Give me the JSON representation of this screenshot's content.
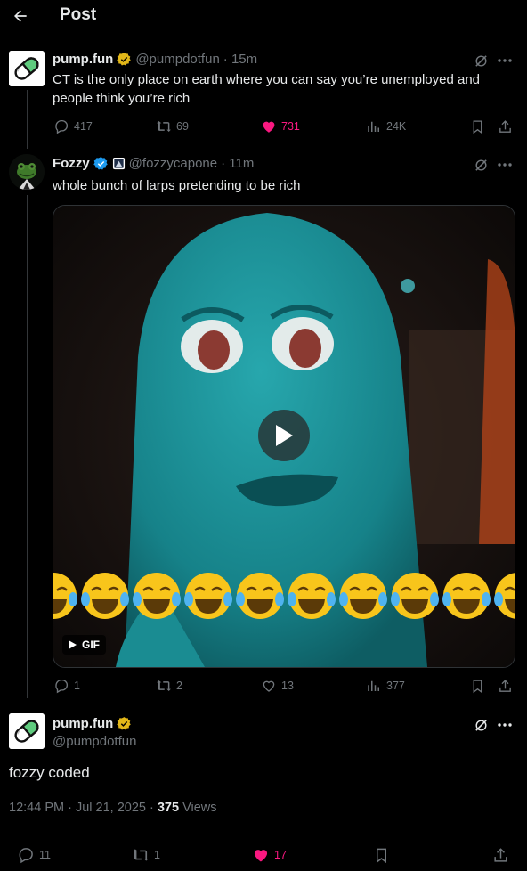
{
  "header": {
    "title": "Post"
  },
  "original_post": {
    "display_name": "pump.fun",
    "handle": "@pumpdotfun",
    "time": "· 15m",
    "text_line1": "CT is the only place on earth where you can say you’re unemployed and",
    "text_line2": "people think you’re rich",
    "replies": "417",
    "reposts": "69",
    "likes": "731",
    "views": "24K"
  },
  "reply_post": {
    "display_name": "Fozzy",
    "handle": "@fozzycapone",
    "time": "· 11m",
    "text": "whole bunch of larps pretending to be rich",
    "media_badge": "GIF",
    "replies": "1",
    "reposts": "2",
    "likes": "13",
    "views": "377"
  },
  "main_post": {
    "display_name": "pump.fun",
    "handle": "@pumpdotfun",
    "text": "fozzy coded",
    "timestamp": "12:44 PM · Jul 21, 2025 ·",
    "views_count": "375",
    "views_label": "Views",
    "replies": "11",
    "reposts": "1",
    "likes": "17"
  },
  "colors": {
    "background": "#000000",
    "muted_text": "#71767b",
    "like_pink": "#f91880",
    "verified_gold": "#e2b719",
    "verified_blue": "#1d9bf0",
    "gif_character": "#1c8d93"
  },
  "icons": [
    "back-arrow-icon",
    "verified-gold-badge-icon",
    "verified-blue-badge-icon",
    "grok-icon",
    "more-icon",
    "reply-icon",
    "repost-icon",
    "heart-icon",
    "views-icon",
    "bookmark-icon",
    "share-icon",
    "play-icon"
  ]
}
